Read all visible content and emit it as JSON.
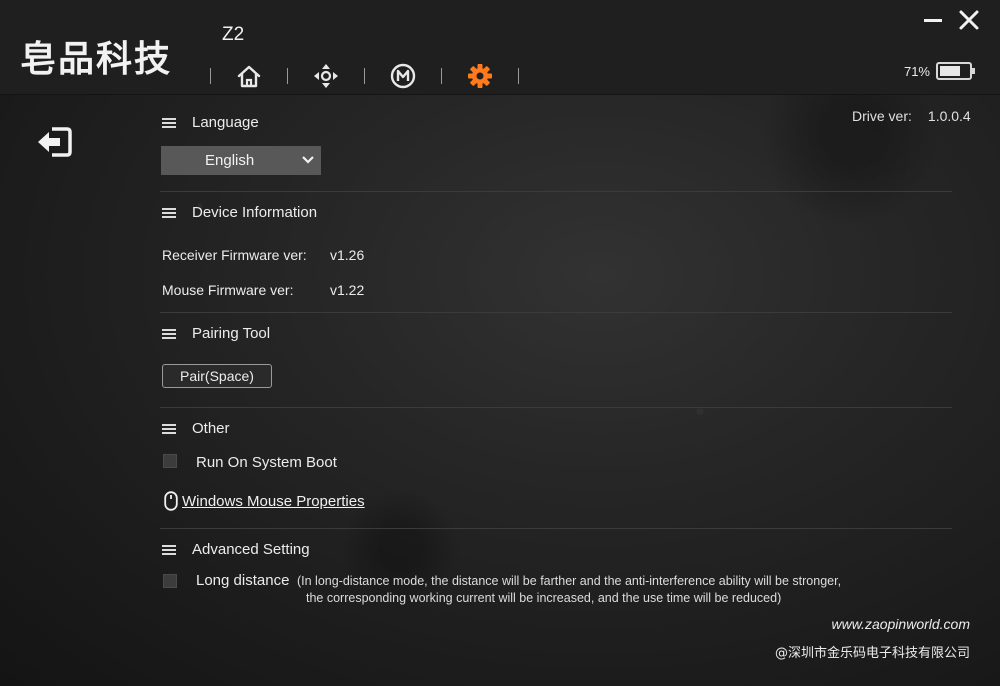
{
  "header": {
    "logo_text": "皂品科技",
    "model": "Z2",
    "nav": [
      {
        "name": "home",
        "icon": "home-icon"
      },
      {
        "name": "dpad",
        "icon": "dpad-icon"
      },
      {
        "name": "macro",
        "icon": "macro-m-icon"
      },
      {
        "name": "settings",
        "icon": "gear-icon",
        "active": true
      }
    ],
    "battery": {
      "percent_label": "71%",
      "level": 0.71
    },
    "accent_color": "#ff7a1a"
  },
  "drive": {
    "label": "Drive ver:",
    "value": "1.0.0.4"
  },
  "language": {
    "title": "Language",
    "selected": "English"
  },
  "device_info": {
    "title": "Device Information",
    "receiver_label": "Receiver Firmware ver:",
    "receiver_value": "v1.26",
    "mouse_label": "Mouse Firmware ver:",
    "mouse_value": "v1.22"
  },
  "pairing": {
    "title": "Pairing Tool",
    "button_label": "Pair(Space)"
  },
  "other": {
    "title": "Other",
    "run_on_boot_label": "Run On System Boot",
    "run_on_boot_checked": false,
    "mouse_properties_link": "Windows Mouse Properties"
  },
  "advanced": {
    "title": "Advanced Setting",
    "long_distance_label": "Long distance",
    "long_distance_checked": false,
    "note_line1": "(In long-distance mode, the distance will be farther and the anti-interference ability will be stronger,",
    "note_line2": "the corresponding working current will be increased, and the use time will be reduced)"
  },
  "footer": {
    "website": "www.zaopinworld.com",
    "copyright": "@深圳市金乐码电子科技有限公司"
  }
}
